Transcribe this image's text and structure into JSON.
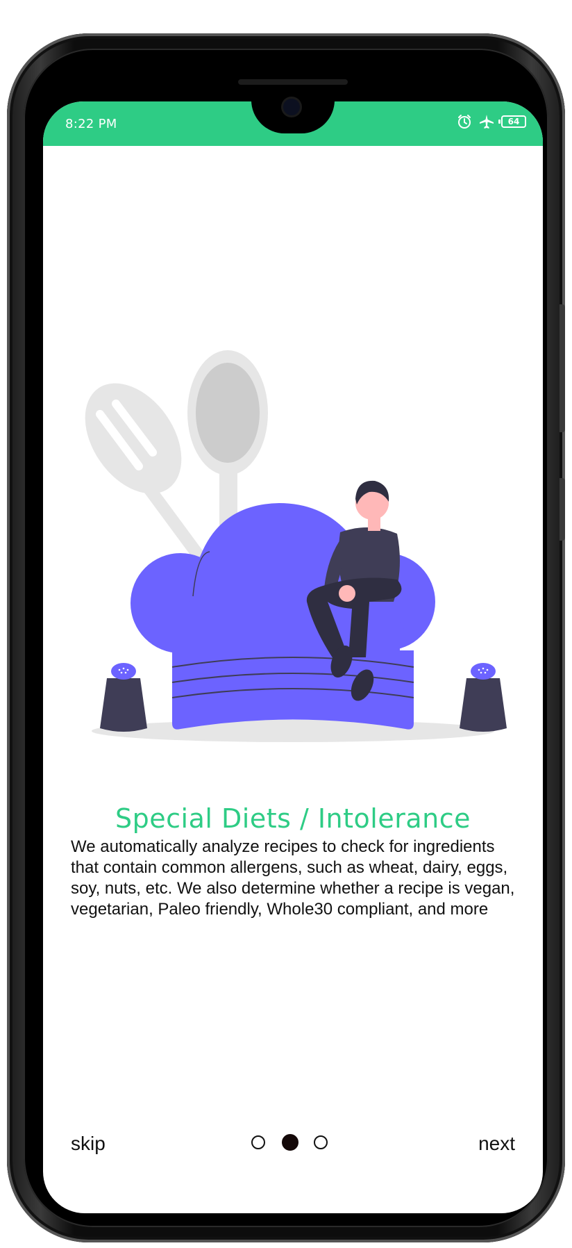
{
  "status_bar": {
    "time": "8:22 PM",
    "icons": [
      "alarm-icon",
      "airplane-mode-icon",
      "battery-icon"
    ],
    "battery_level": "64",
    "background_color": "#2ecc85"
  },
  "slide": {
    "title": "Special Diets / Intolerance",
    "description": "We automatically analyze recipes to check for ingredients that contain common allergens, such as wheat, dairy, eggs, soy, nuts, etc. We also determine whether a recipe is vegan, vegetarian, Paleo friendly, Whole30 compliant, and more",
    "title_color": "#2ecc85",
    "illustration_accent": "#6c63ff"
  },
  "navigation": {
    "skip_label": "skip",
    "next_label": "next",
    "page_count": 3,
    "current_page": 2
  }
}
